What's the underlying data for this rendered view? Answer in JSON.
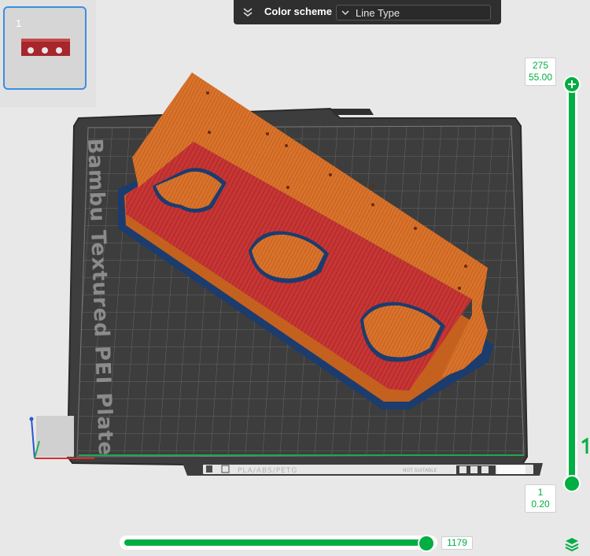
{
  "plate_list": {
    "selected_index": "1"
  },
  "color_scheme": {
    "title": "Color scheme",
    "value": "Line Type"
  },
  "bed": {
    "name": "Bambu Textured PEI Plate",
    "filament_text": "PLA/ABS/PETG",
    "badge_text": "NOT SUITABLE"
  },
  "layer_slider": {
    "top_layer": "275",
    "top_height": "55.00",
    "bottom_layer": "1",
    "bottom_height": "0.20"
  },
  "move_slider": {
    "value": "1179"
  },
  "colors": {
    "accent": "#00ae42",
    "selection_border": "#3b8fe0",
    "wall_orange": "#d9712a",
    "top_surface_red": "#c83434",
    "brim_blue": "#1c3c6e",
    "bed_dark": "#3d3d3d"
  }
}
